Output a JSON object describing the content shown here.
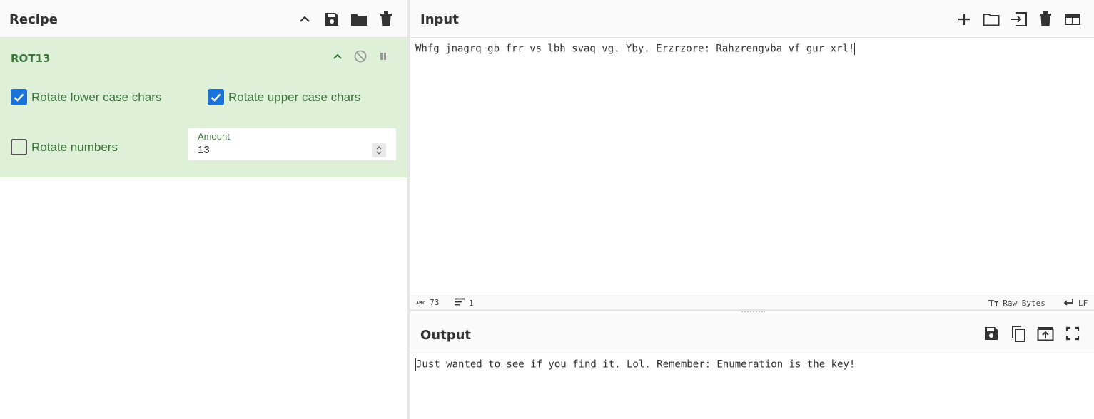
{
  "recipe": {
    "title": "Recipe",
    "header_icons": [
      "chevron-up-icon",
      "save-icon",
      "folder-icon",
      "trash-icon"
    ],
    "operation": {
      "name": "ROT13",
      "icons": [
        "chevron-up-icon",
        "disable-icon",
        "pause-icon"
      ],
      "rotate_lower": {
        "label": "Rotate lower case chars",
        "checked": true
      },
      "rotate_upper": {
        "label": "Rotate upper case chars",
        "checked": true
      },
      "rotate_numbers": {
        "label": "Rotate numbers",
        "checked": false
      },
      "amount": {
        "label": "Amount",
        "value": "13"
      }
    }
  },
  "input": {
    "title": "Input",
    "header_icons": [
      "plus-icon",
      "folder-icon",
      "load-icon",
      "trash-icon",
      "layout-icon"
    ],
    "text": "Whfg jnagrq gb frr vs lbh svaq vg. Yby. Erzrzore: Rahzrengvba vf gur xrl!",
    "status": {
      "chars_icon": "abc-icon",
      "chars": "73",
      "lines_icon": "lines-icon",
      "lines": "1",
      "encoding_icon": "text-size-icon",
      "encoding": "Raw Bytes",
      "eol_icon": "return-icon",
      "eol": "LF"
    }
  },
  "output": {
    "title": "Output",
    "header_icons": [
      "save-icon",
      "copy-icon",
      "replace-input-icon",
      "maximize-icon"
    ],
    "text": "Just wanted to see if you find it. Lol. Remember: Enumeration is the key!"
  },
  "colors": {
    "op_bg": "#dff0d8",
    "op_text": "#3c763d",
    "checkbox": "#1a73d9"
  }
}
